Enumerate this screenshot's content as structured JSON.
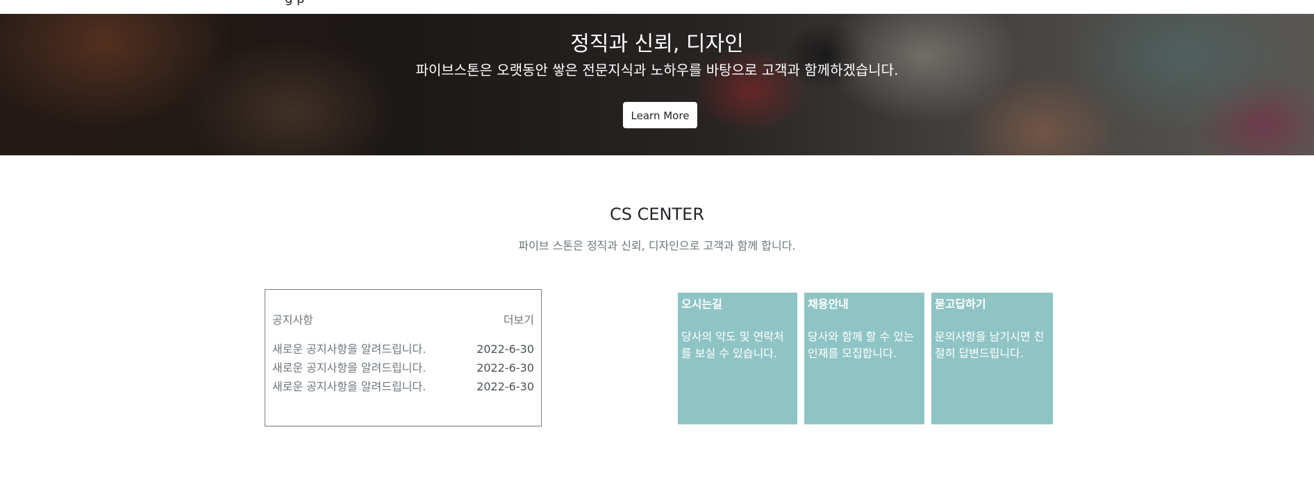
{
  "header": {
    "cut_text": "g  p"
  },
  "hero": {
    "title": "정직과 신뢰, 디자인",
    "subtitle": "파이브스톤은 오랫동안 쌓은 전문지식과 노하우를 바탕으로 고객과 함께하겠습니다.",
    "button_label": "Learn More"
  },
  "cs": {
    "title": "CS CENTER",
    "subtitle": "파이브 스톤은 정직과 신뢰, 디자인으로 고객과 함께 합니다."
  },
  "notice": {
    "title": "공지사항",
    "more_label": "더보기",
    "items": [
      {
        "text": "새로운 공지사항을 알려드립니다.",
        "date": "2022-6-30"
      },
      {
        "text": "새로운 공지사항을 알려드립니다.",
        "date": "2022-6-30"
      },
      {
        "text": "새로운 공지사항을 알려드립니다.",
        "date": "2022-6-30"
      }
    ]
  },
  "cards": [
    {
      "title": "오시는길",
      "text": "당사의 약도 및 연락처를 보실 수 있습니다."
    },
    {
      "title": "채용안내",
      "text": "당사와 함께 할 수 있는 인재를 모집합니다."
    },
    {
      "title": "묻고답하기",
      "text": "문의사항을 남기시면 친절히 답변드립니다."
    }
  ],
  "colors": {
    "card_bg": "#8fc4c4",
    "notice_border": "#7a7a7a",
    "muted_text": "#6c757d"
  }
}
